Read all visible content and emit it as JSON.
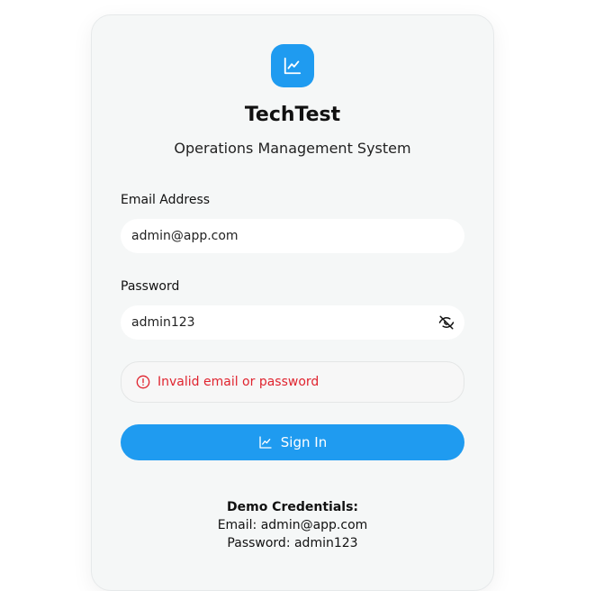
{
  "app": {
    "name": "TechTest",
    "subtitle": "Operations Management System"
  },
  "form": {
    "email_label": "Email Address",
    "email_value": "admin@app.com",
    "password_label": "Password",
    "password_value": "admin123",
    "error_message": "Invalid email or password",
    "submit_label": "Sign In"
  },
  "demo": {
    "title": "Demo Credentials:",
    "email_line": "Email: admin@app.com",
    "password_line": "Password: admin123"
  },
  "icons": {
    "logo": "chart-line-icon",
    "password_toggle": "eye-off-icon",
    "error": "alert-circle-icon",
    "submit": "chart-line-icon"
  },
  "colors": {
    "accent": "#1f9bf0",
    "error": "#e0242f",
    "card_background": "#f5f7f7"
  }
}
